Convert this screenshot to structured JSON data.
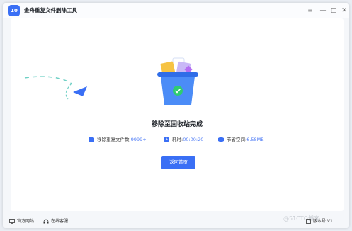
{
  "app": {
    "title": "金舟重复文件删除工具",
    "logo_text": "10",
    "accent_color": "#3a6ff5"
  },
  "window_controls": {
    "menu_icon": "≡",
    "minimize_icon": "—",
    "maximize_icon": "□",
    "close_icon": "✕"
  },
  "main": {
    "status_title": "移除至回收站完成",
    "stats": [
      {
        "icon": "file-icon",
        "label": "移除重复文件数:",
        "value": "9999+"
      },
      {
        "icon": "clock-icon",
        "label": "耗时:",
        "value": "00:00:20"
      },
      {
        "icon": "disk-icon",
        "label": "节省空间:",
        "value": "6.58MB"
      }
    ],
    "home_button": "返回首页"
  },
  "footer": {
    "website": "官方网站",
    "support": "在线客服",
    "watermark": "@51CTO博客",
    "version": "版本号 V1"
  }
}
